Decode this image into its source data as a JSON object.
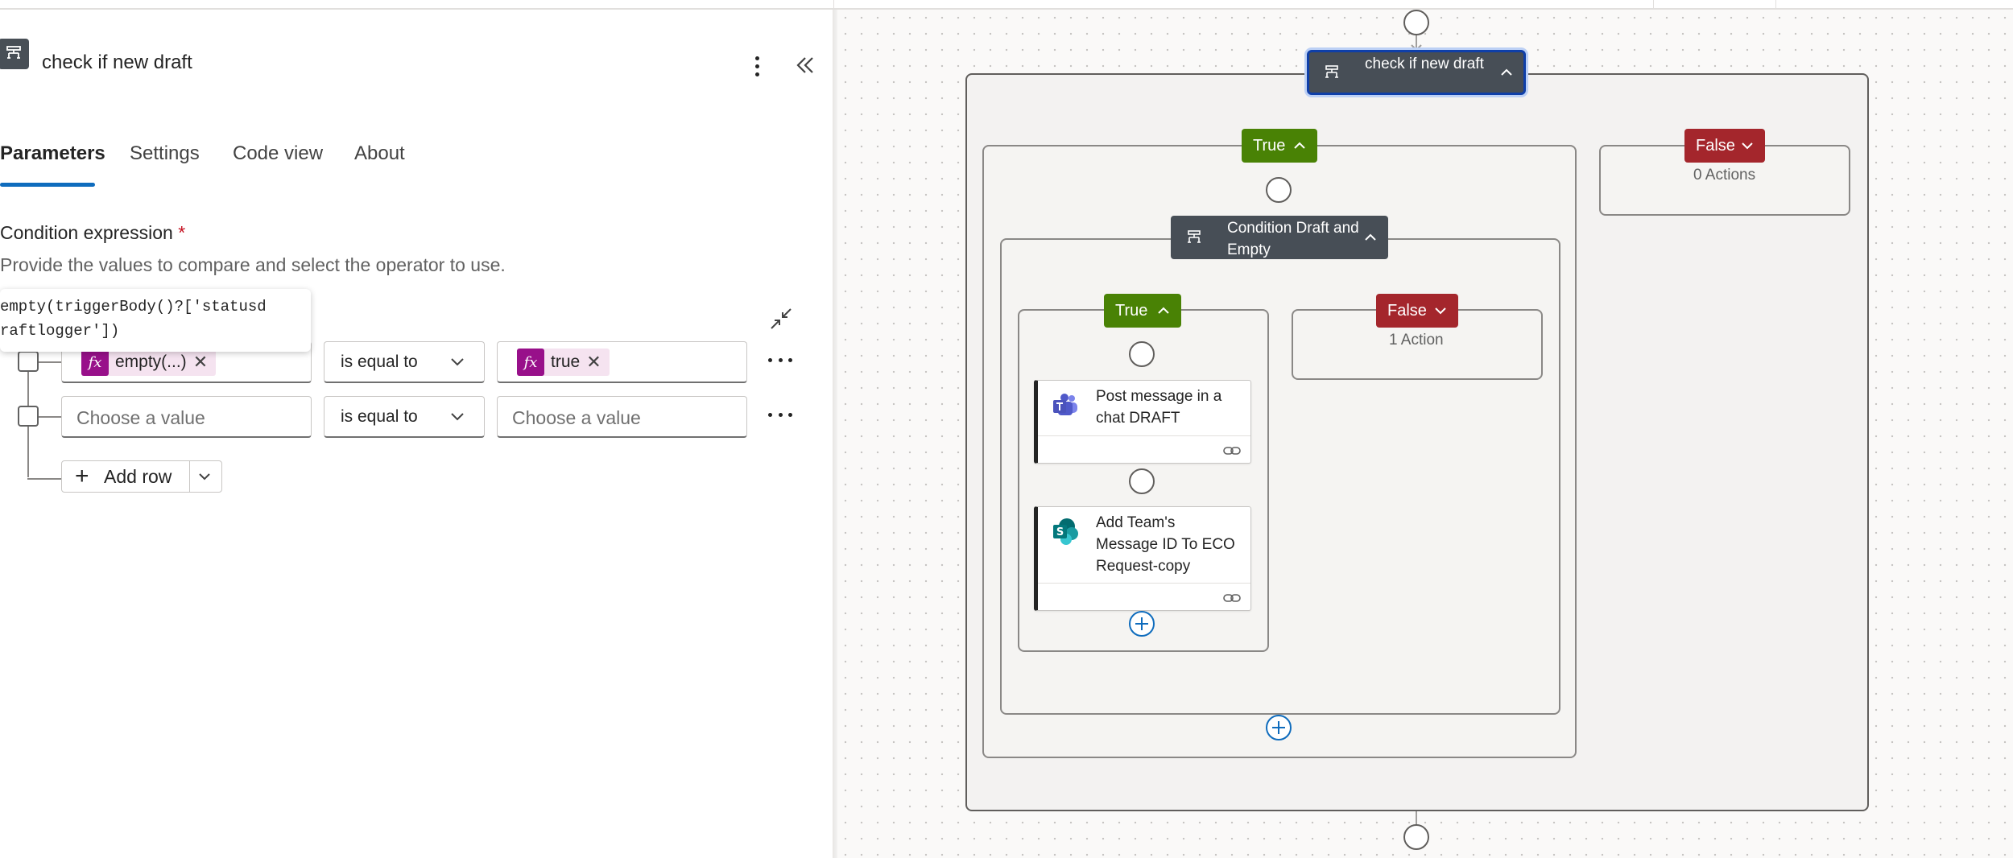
{
  "panel": {
    "title": "check if new draft",
    "tabs": [
      {
        "label": "Parameters"
      },
      {
        "label": "Settings"
      },
      {
        "label": "Code view"
      },
      {
        "label": "About"
      }
    ],
    "condition_label": "Condition expression",
    "required_mark": "*",
    "description": "Provide the values to compare and select the operator to use.",
    "tooltip_text": "empty(triggerBody()?['statusd\nraftlogger'])",
    "rows": [
      {
        "left_token": "empty(...)",
        "operator": "is equal to",
        "right_token": "true"
      },
      {
        "left_placeholder": "Choose a value",
        "operator": "is equal to",
        "right_placeholder": "Choose a value"
      }
    ],
    "add_row_label": "Add row"
  },
  "canvas": {
    "top_node": "check if new draft",
    "true_label": "True",
    "false_label": "False",
    "false_top_count": "0 Actions",
    "inner_node": "Condition Draft and Empty",
    "inner_true_label": "True",
    "inner_false_label": "False",
    "inner_false_count": "1 Action",
    "card_teams": "Post message in a chat DRAFT",
    "card_sharepoint": "Add Team's Message ID To ECO Request-copy"
  },
  "colors": {
    "accent": "#0f6cbd",
    "true_green": "#498205",
    "false_red": "#a4262c",
    "node_dark": "#474e56",
    "fx_purple": "#98108a"
  },
  "icons": [
    "condition-icon",
    "kebab-icon",
    "collapse-panel-icon",
    "shrink-icon",
    "fx-icon",
    "chevron-down-icon",
    "chevron-up-icon",
    "teams-icon",
    "sharepoint-icon",
    "link-icon",
    "plus-icon"
  ]
}
